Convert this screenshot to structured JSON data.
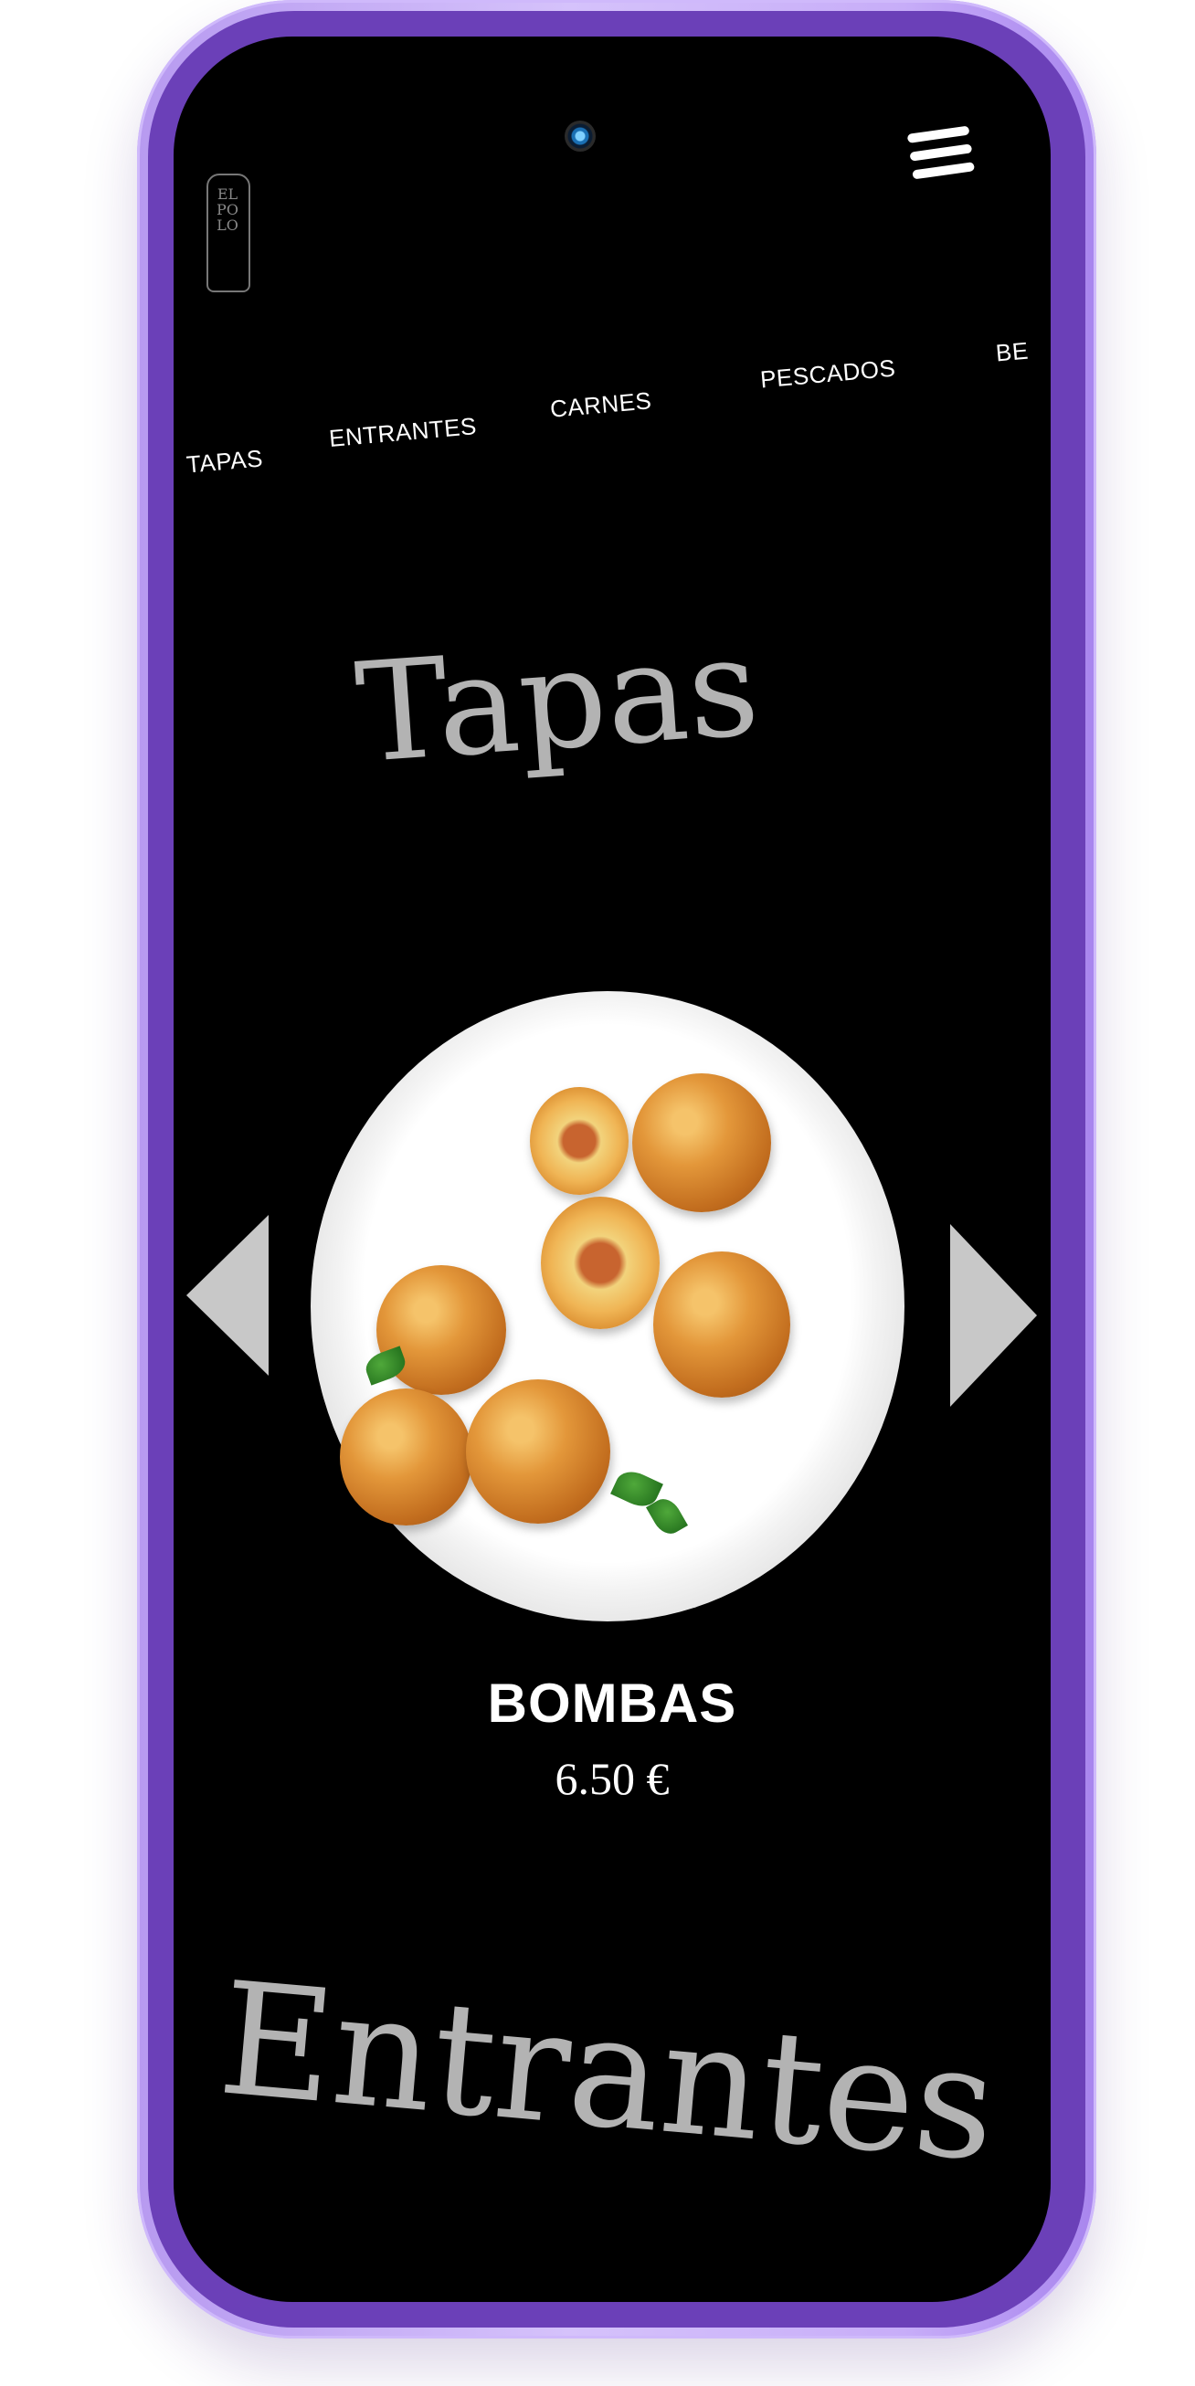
{
  "app": {
    "logo_text": "ELPOLO"
  },
  "header": {
    "menu_icon": "hamburger-menu-icon"
  },
  "categories": [
    {
      "label": "TAPAS"
    },
    {
      "label": "ENTRANTES"
    },
    {
      "label": "CARNES"
    },
    {
      "label": "PESCADOS"
    },
    {
      "label": "BE"
    }
  ],
  "sections": {
    "current": "Tapas",
    "next": "Entrantes"
  },
  "carousel": {
    "prev_icon": "chevron-left-icon",
    "next_icon": "chevron-right-icon",
    "item": {
      "name": "BOMBAS",
      "price": "6.50 €",
      "image": "croquettes-on-plate"
    }
  },
  "colors": {
    "screen_bg": "#000000",
    "phone_frame": "#c7adf8",
    "section_title": "#b3b3b3",
    "arrow": "#c8c8c8",
    "text": "#ffffff"
  }
}
